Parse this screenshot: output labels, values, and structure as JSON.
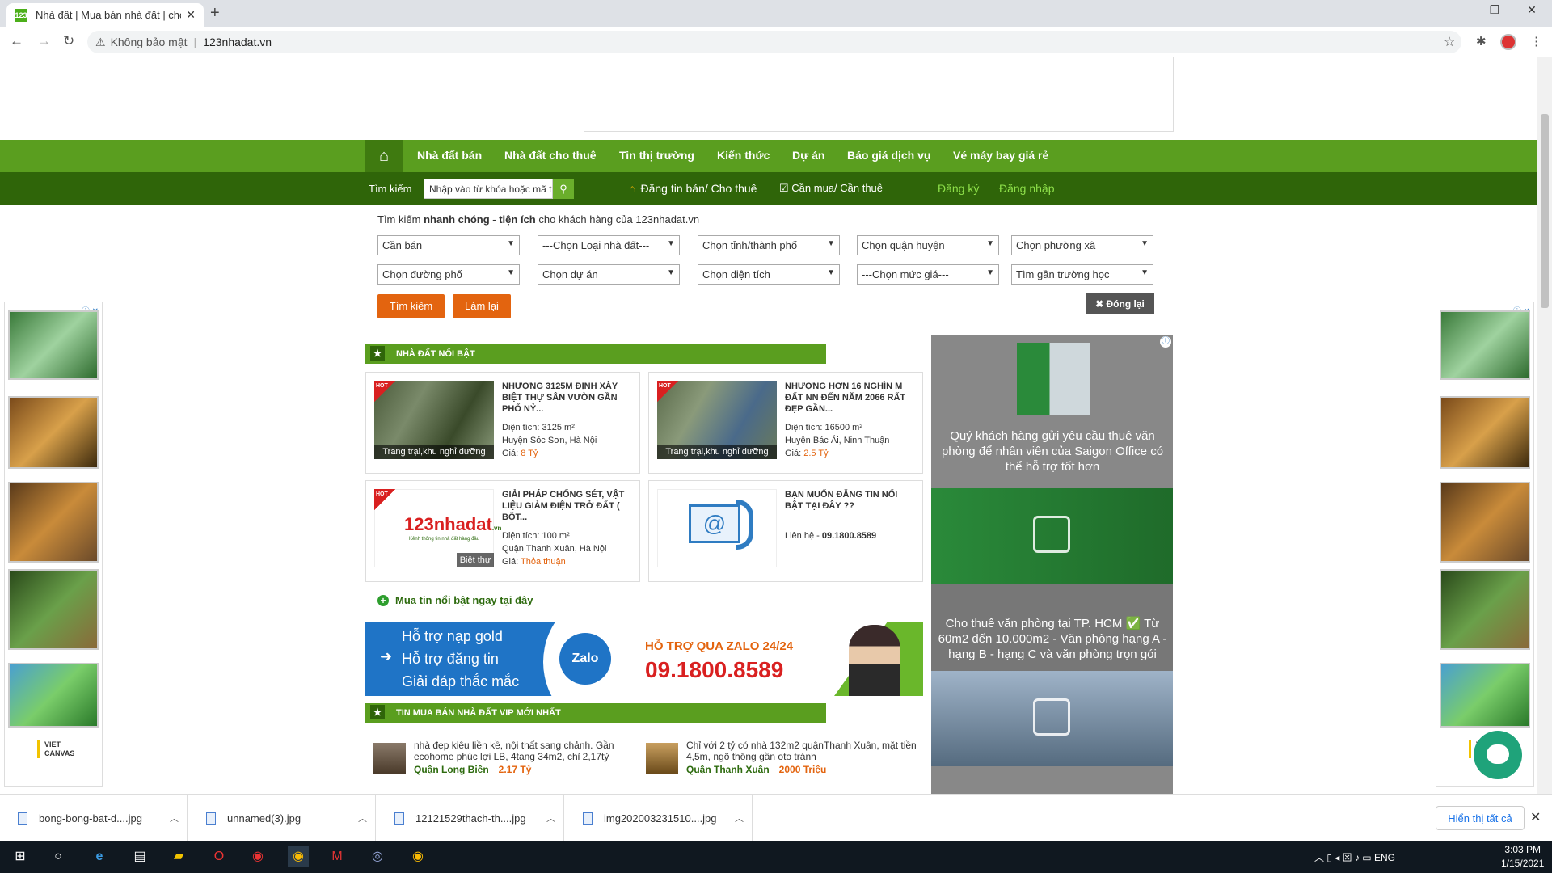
{
  "browser": {
    "tab_title": "Nhà đất | Mua bán nhà đất | cho",
    "address_warning": "Không bảo mật",
    "url": "123nhadat.vn"
  },
  "nav": {
    "items": [
      "Nhà đất bán",
      "Nhà đất cho thuê",
      "Tin thị trường",
      "Kiến thức",
      "Dự án",
      "Báo giá dịch vụ",
      "Vé máy bay giá rẻ"
    ]
  },
  "subnav": {
    "search_label": "Tìm kiếm",
    "search_placeholder": "Nhập vào từ khóa hoặc mã tin",
    "post_label": "Đăng tin bán/ Cho thuê",
    "need_label": "Cần mua/ Cần thuê",
    "register": "Đăng ký",
    "login": "Đăng nhập"
  },
  "search": {
    "intro_prefix": "Tìm kiếm ",
    "intro_bold": "nhanh chóng - tiện ích",
    "intro_suffix": " cho khách hàng của 123nhadat.vn",
    "selects_row1": [
      "Cần bán",
      "---Chọn Loại nhà đất---",
      "Chọn tỉnh/thành phố",
      "Chọn quận huyện",
      "Chọn phường xã"
    ],
    "selects_row2": [
      "Chọn đường phố",
      "Chọn dự án",
      "Chọn diện tích",
      "---Chọn mức giá---",
      "Tìm gần trường học"
    ],
    "search_btn": "Tìm kiếm",
    "reset_btn": "Làm lại",
    "close_btn": "Đóng lại"
  },
  "featured": {
    "heading": "NHÀ ĐẤT NỔI BẬT",
    "cards": [
      {
        "title": "NHƯỢNG 3125M ĐỊNH XÂY BIỆT THỰ SÂN VƯỜN GẦN PHỐ NỶ...",
        "area": "Diện tích: 3125 m²",
        "location": "Huyện Sóc Sơn, Hà Nội",
        "price_label": "Giá: ",
        "price": "8 Tỷ",
        "caption": "Trang trại,khu nghỉ dưỡng",
        "hot": "HOT"
      },
      {
        "title": "NHƯỢNG HƠN 16 NGHÌN M ĐẤT NN ĐẾN NĂM 2066 RẤT ĐẸP GẦN...",
        "area": "Diện tích: 16500 m²",
        "location": "Huyện Bác Ái, Ninh Thuận",
        "price_label": "Giá: ",
        "price": "2.5 Tỷ",
        "caption": "Trang trại,khu nghỉ dưỡng",
        "hot": "HOT"
      },
      {
        "title": "GIẢI PHÁP CHỐNG SÉT, VẬT LIỆU GIẢM ĐIỆN TRỞ ĐẤT ( BỘT...",
        "area": "Diện tích: 100 m²",
        "location": "Quận Thanh Xuân, Hà Nội",
        "price_label": "Giá: ",
        "price": "Thỏa thuận",
        "caption": "Biệt thự",
        "hot": "HOT",
        "logo": "123nhadat",
        "logo_sub": "Kênh thông tin nhà đất hàng đầu",
        "logo_vn": ".vn"
      },
      {
        "title": "BẠN MUỐN ĐĂNG TIN NỔI BẬT TẠI ĐÂY ??",
        "contact_label": "Liên hệ - ",
        "contact": "09.1800.8589"
      }
    ],
    "buy_link": "Mua tin nổi bật ngay tại đây"
  },
  "zalo_banner": {
    "lines": [
      "Hỗ trợ nạp gold",
      "Hỗ trợ đăng tin",
      "Giải đáp thắc mắc"
    ],
    "logo": "Zalo",
    "heading": "HỖ TRỢ QUA ZALO 24/24",
    "phone": "09.1800.8589"
  },
  "vip": {
    "heading": "TIN MUA BÁN NHÀ ĐẤT VIP MỚI NHẤT",
    "items": [
      {
        "title": "nhà đẹp kiêu liền kề, nội thất sang chảnh. Gần ecohome phúc lợi LB, 4tang 34m2, chỉ 2,17tỷ",
        "location": "Quận Long Biên",
        "price": "2.17 Tỷ"
      },
      {
        "title": "Chỉ với 2 tỷ có nhà 132m2 quậnThanh Xuân, mặt tiền 4,5m, ngõ thông gần oto tránh",
        "location": "Quận Thanh Xuân",
        "price": "2000 Triệu"
      }
    ]
  },
  "right_ad": {
    "text1": "Quý khách hàng gửi yêu cầu thuê văn phòng để nhân viên của Saigon Office có thể hỗ trợ tốt hơn",
    "text2": "Cho thuê văn phòng tại TP. HCM ✅ Từ 60m2 đến 10.000m2 - Văn phòng hạng A - hạng B - hạng C và văn phòng trọn gói"
  },
  "side_ads": {
    "brand_line1": "VIET",
    "brand_line2": "CANVAS"
  },
  "downloads": {
    "files": [
      "bong-bong-bat-d....jpg",
      "unnamed(3).jpg",
      "12121529thach-th....jpg",
      "img202003231510....jpg"
    ],
    "show_all": "Hiển thị tất cả"
  },
  "taskbar": {
    "lang": "ENG",
    "time": "3:03 PM",
    "date": "1/15/2021"
  }
}
